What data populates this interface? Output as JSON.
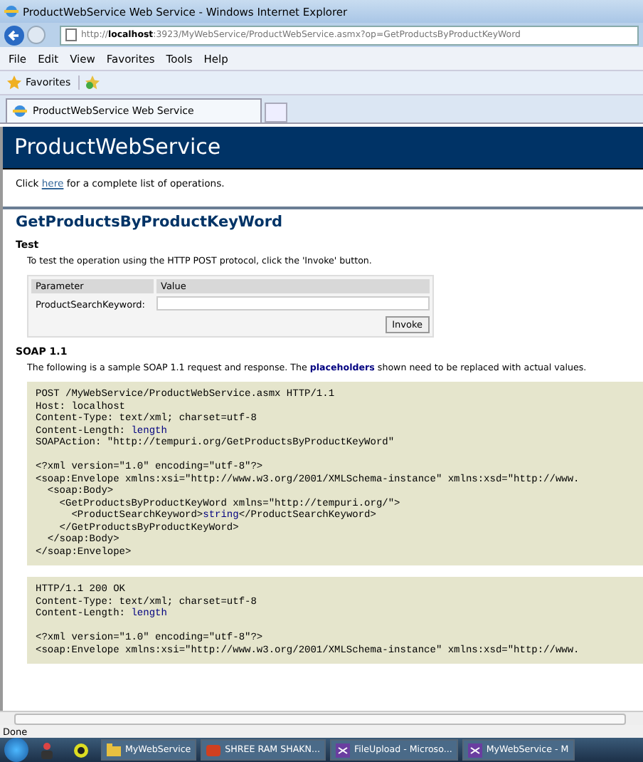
{
  "window": {
    "title": "ProductWebService Web Service - Windows Internet Explorer"
  },
  "address_bar": {
    "prefix": "http://",
    "host": "localhost",
    "rest": ":3923/MyWebService/ProductWebService.asmx?op=GetProductsByProductKeyWord"
  },
  "menu": [
    "File",
    "Edit",
    "View",
    "Favorites",
    "Tools",
    "Help"
  ],
  "favorites_bar": {
    "label": "Favorites"
  },
  "tabs": [
    {
      "label": "ProductWebService Web Service",
      "selected": true
    }
  ],
  "page": {
    "banner": "ProductWebService",
    "intro": {
      "before": "Click ",
      "link": "here",
      "after": " for a complete list of operations."
    },
    "operation": "GetProductsByProductKeyWord",
    "test": {
      "heading": "Test",
      "text": "To test the operation using the HTTP POST protocol, click the 'Invoke' button.",
      "columns": [
        "Parameter",
        "Value"
      ],
      "params": [
        {
          "label": "ProductSearchKeyword:"
        }
      ],
      "button": "Invoke"
    },
    "soap": {
      "heading": "SOAP 1.1",
      "text": "The following is a sample SOAP 1.1 request and response. The **placeholders** shown need to be replaced with actual values.",
      "blocks": [
        [
          [
            {
              "kind": "plain",
              "text": "POST /MyWebService/ProductWebService.asmx HTTP/1.1"
            }
          ],
          [
            {
              "kind": "plain",
              "text": "Host: localhost"
            }
          ],
          [
            {
              "kind": "plain",
              "text": "Content-Type: text/xml; charset=utf-8"
            }
          ],
          [
            {
              "kind": "plain",
              "text": "Content-Length: "
            },
            {
              "kind": "placeholder",
              "text": "length"
            }
          ],
          [
            {
              "kind": "plain",
              "text": "SOAPAction: \"http://tempuri.org/GetProductsByProductKeyWord\""
            }
          ],
          [
            {
              "kind": "blank"
            }
          ],
          [
            {
              "kind": "plain",
              "text": "<?xml version=\"1.0\" encoding=\"utf-8\"?>"
            }
          ],
          [
            {
              "kind": "plain",
              "text": "<soap:Envelope xmlns:xsi=\"http://www.w3.org/2001/XMLSchema-instance\" xmlns:xsd=\"http://www."
            }
          ],
          [
            {
              "kind": "plain",
              "text": "  <soap:Body>"
            }
          ],
          [
            {
              "kind": "plain",
              "text": "    <GetProductsByProductKeyWord xmlns=\"http://tempuri.org/\">"
            }
          ],
          [
            {
              "kind": "plain",
              "text": "      <ProductSearchKeyword>"
            },
            {
              "kind": "placeholder",
              "text": "string"
            },
            {
              "kind": "plain",
              "text": "</ProductSearchKeyword>"
            }
          ],
          [
            {
              "kind": "plain",
              "text": "    </GetProductsByProductKeyWord>"
            }
          ],
          [
            {
              "kind": "plain",
              "text": "  </soap:Body>"
            }
          ],
          [
            {
              "kind": "plain",
              "text": "</soap:Envelope>"
            }
          ]
        ],
        [
          [
            {
              "kind": "plain",
              "text": "HTTP/1.1 200 OK"
            }
          ],
          [
            {
              "kind": "plain",
              "text": "Content-Type: text/xml; charset=utf-8"
            }
          ],
          [
            {
              "kind": "plain",
              "text": "Content-Length: "
            },
            {
              "kind": "placeholder",
              "text": "length"
            }
          ],
          [
            {
              "kind": "blank"
            }
          ],
          [
            {
              "kind": "plain",
              "text": "<?xml version=\"1.0\" encoding=\"utf-8\"?>"
            }
          ],
          [
            {
              "kind": "plain",
              "text": "<soap:Envelope xmlns:xsi=\"http://www.w3.org/2001/XMLSchema-instance\" xmlns:xsd=\"http://www."
            }
          ]
        ]
      ]
    }
  },
  "status_bar": {
    "text": "Done"
  },
  "taskbar": [
    {
      "label": "MyWebService",
      "kind": "folder"
    },
    {
      "label": "SHREE RAM SHAKN...",
      "kind": "app"
    },
    {
      "label": "FileUpload - Microso...",
      "kind": "studio"
    },
    {
      "label": "MyWebService - M",
      "kind": "studio"
    }
  ]
}
